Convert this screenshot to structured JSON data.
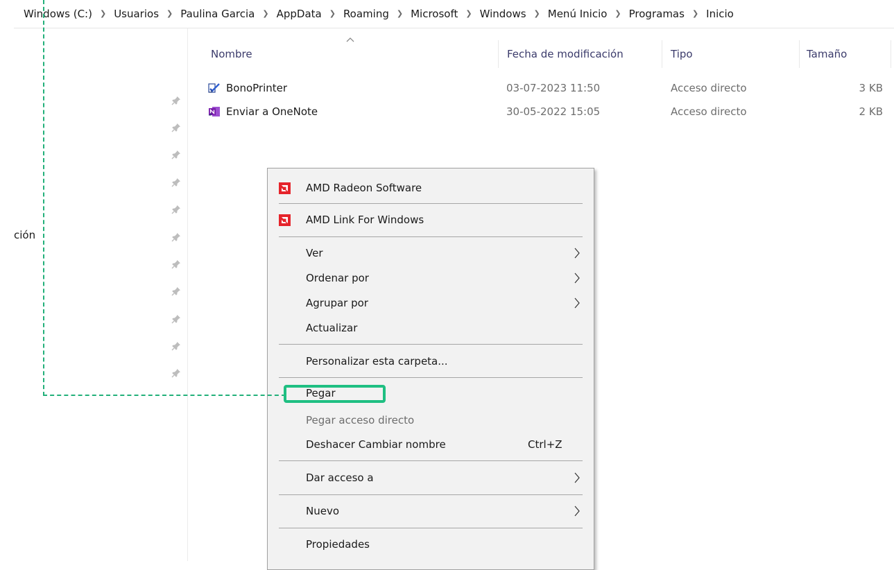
{
  "breadcrumb": [
    "Windows (C:)",
    "Usuarios",
    "Paulina Garcia",
    "AppData",
    "Roaming",
    "Microsoft",
    "Windows",
    "Menú Inicio",
    "Programas",
    "Inicio"
  ],
  "nav_pane": {
    "partial_label": "ción"
  },
  "columns": {
    "name": "Nombre",
    "date": "Fecha de modificación",
    "type": "Tipo",
    "size": "Tamaño"
  },
  "files": [
    {
      "name": "BonoPrinter",
      "date": "03-07-2023 11:50",
      "type": "Acceso directo",
      "size": "3 KB",
      "icon": "bonoprinter-shortcut-icon"
    },
    {
      "name": "Enviar a OneNote",
      "date": "30-05-2022 15:05",
      "type": "Acceso directo",
      "size": "2 KB",
      "icon": "onenote-shortcut-icon"
    }
  ],
  "context_menu": {
    "amd_radeon": "AMD Radeon Software",
    "amd_link": "AMD Link For Windows",
    "ver": "Ver",
    "ordenar": "Ordenar por",
    "agrupar": "Agrupar por",
    "actualizar": "Actualizar",
    "personalizar": "Personalizar esta carpeta...",
    "pegar": "Pegar",
    "pegar_acceso": "Pegar acceso directo",
    "deshacer": "Deshacer Cambiar nombre",
    "deshacer_shortcut": "Ctrl+Z",
    "dar_acceso": "Dar acceso a",
    "nuevo": "Nuevo",
    "propiedades": "Propiedades"
  },
  "colors": {
    "annotation": "#1fbf82",
    "amd_red": "#e5242b",
    "menu_bg": "#f2f2f2"
  }
}
